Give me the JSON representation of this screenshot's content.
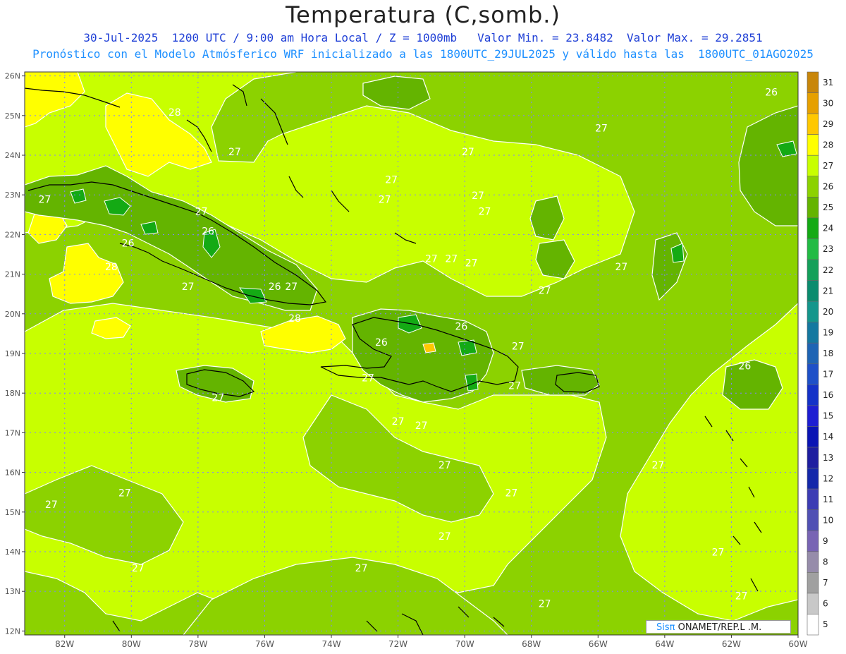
{
  "header": {
    "title": "Temperatura (C,somb.)",
    "line1": "30-Jul-2025  1200 UTC / 9:00 am Hora Local / Z = 1000mb   Valor Min. = 23.8482  Valor Max. = 29.2851",
    "line2": "Pronóstico con el Modelo Atmósferico WRF inicializado a las 1800UTC_29JUL2025 y válido hasta las  1800UTC_01AGO2025"
  },
  "map": {
    "lon_labels": [
      "82W",
      "80W",
      "78W",
      "76W",
      "74W",
      "72W",
      "70W",
      "68W",
      "66W",
      "64W",
      "62W",
      "60W"
    ],
    "lat_labels": [
      "26N",
      "25N",
      "24N",
      "23N",
      "22N",
      "21N",
      "20N",
      "19N",
      "18N",
      "17N",
      "16N",
      "15N",
      "14N",
      "13N",
      "12N"
    ],
    "contour_labels": [
      {
        "text": "27",
        "lon": -82.6,
        "lat": 22.8
      },
      {
        "text": "27",
        "lon": -77.9,
        "lat": 22.5
      },
      {
        "text": "26",
        "lon": -77.7,
        "lat": 22.0
      },
      {
        "text": "26",
        "lon": -80.1,
        "lat": 21.7
      },
      {
        "text": "28",
        "lon": -80.6,
        "lat": 21.1
      },
      {
        "text": "27",
        "lon": -78.3,
        "lat": 20.6
      },
      {
        "text": "26",
        "lon": -75.7,
        "lat": 20.6
      },
      {
        "text": "27",
        "lon": -75.2,
        "lat": 20.6
      },
      {
        "text": "28",
        "lon": -75.1,
        "lat": 19.8
      },
      {
        "text": "28",
        "lon": -78.7,
        "lat": 25.0
      },
      {
        "text": "27",
        "lon": -76.9,
        "lat": 24.0
      },
      {
        "text": "27",
        "lon": -72.2,
        "lat": 23.3
      },
      {
        "text": "27",
        "lon": -72.4,
        "lat": 22.8
      },
      {
        "text": "27",
        "lon": -69.6,
        "lat": 22.9
      },
      {
        "text": "27",
        "lon": -69.4,
        "lat": 22.5
      },
      {
        "text": "27",
        "lon": -71.0,
        "lat": 21.3
      },
      {
        "text": "27",
        "lon": -70.4,
        "lat": 21.3
      },
      {
        "text": "27",
        "lon": -69.8,
        "lat": 21.2
      },
      {
        "text": "26",
        "lon": -72.5,
        "lat": 19.2
      },
      {
        "text": "26",
        "lon": -70.1,
        "lat": 19.6
      },
      {
        "text": "27",
        "lon": -68.4,
        "lat": 19.1
      },
      {
        "text": "27",
        "lon": -72.9,
        "lat": 18.3
      },
      {
        "text": "27",
        "lon": -68.5,
        "lat": 18.1
      },
      {
        "text": "27",
        "lon": -77.4,
        "lat": 17.8
      },
      {
        "text": "27",
        "lon": -72.0,
        "lat": 17.2
      },
      {
        "text": "27",
        "lon": -71.3,
        "lat": 17.1
      },
      {
        "text": "27",
        "lon": -70.6,
        "lat": 16.1
      },
      {
        "text": "27",
        "lon": -68.6,
        "lat": 15.4
      },
      {
        "text": "27",
        "lon": -80.2,
        "lat": 15.4
      },
      {
        "text": "27",
        "lon": -82.4,
        "lat": 15.1
      },
      {
        "text": "27",
        "lon": -70.6,
        "lat": 14.3
      },
      {
        "text": "27",
        "lon": -79.8,
        "lat": 13.5
      },
      {
        "text": "27",
        "lon": -73.1,
        "lat": 13.5
      },
      {
        "text": "27",
        "lon": -67.6,
        "lat": 12.6
      },
      {
        "text": "27",
        "lon": -65.3,
        "lat": 21.1
      },
      {
        "text": "27",
        "lon": -67.6,
        "lat": 20.5
      },
      {
        "text": "27",
        "lon": -65.9,
        "lat": 24.6
      },
      {
        "text": "26",
        "lon": -60.8,
        "lat": 25.5
      },
      {
        "text": "26",
        "lon": -61.6,
        "lat": 18.6
      },
      {
        "text": "27",
        "lon": -64.2,
        "lat": 16.1
      },
      {
        "text": "27",
        "lon": -62.4,
        "lat": 13.9
      },
      {
        "text": "27",
        "lon": -61.7,
        "lat": 12.8
      },
      {
        "text": "27",
        "lon": -69.9,
        "lat": 24.0
      }
    ]
  },
  "legend": {
    "levels": [
      "31",
      "30",
      "29",
      "28",
      "27",
      "26",
      "25",
      "24",
      "23",
      "22",
      "21",
      "20",
      "19",
      "18",
      "17",
      "16",
      "15",
      "14",
      "13",
      "12",
      "11",
      "10",
      "9",
      "8",
      "7",
      "6",
      "5"
    ],
    "colors": [
      "#c8860a",
      "#e6a000",
      "#ffc800",
      "#ffff00",
      "#c8ff00",
      "#8cd200",
      "#64b400",
      "#14aa14",
      "#22bb44",
      "#14a05a",
      "#0a8c6e",
      "#14968c",
      "#1478a0",
      "#1e64b4",
      "#1e50c8",
      "#1432c8",
      "#1e1ed2",
      "#0a14b4",
      "#1e1ea0",
      "#1428aa",
      "#3c3cb4",
      "#5050b4",
      "#7864b4",
      "#968caa",
      "#a0a0a0",
      "#c8c8c8",
      "#ffffff"
    ]
  },
  "credit": {
    "sis": "Sisπ",
    "text": " ONAMET/REP.L .M."
  }
}
